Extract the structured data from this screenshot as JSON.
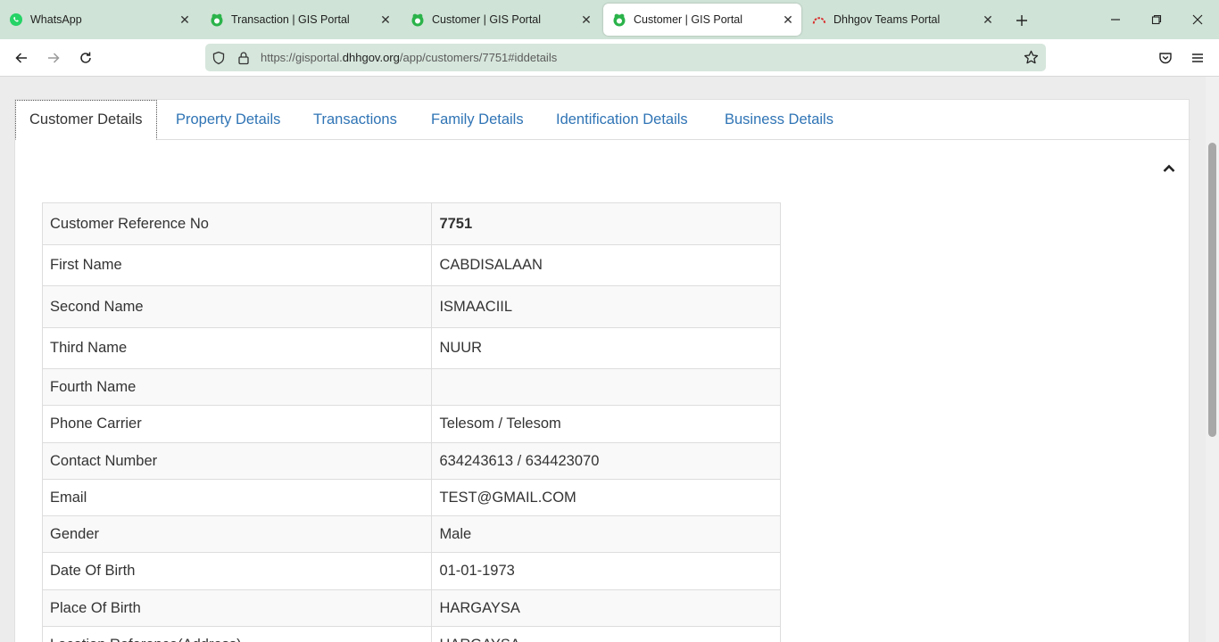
{
  "browser": {
    "tabs": [
      {
        "title": "WhatsApp",
        "icon": "whatsapp-icon",
        "active": false
      },
      {
        "title": "Transaction | GIS Portal",
        "icon": "gis-portal-icon",
        "active": false
      },
      {
        "title": "Customer | GIS Portal",
        "icon": "gis-portal-icon",
        "active": false
      },
      {
        "title": "Customer | GIS Portal",
        "icon": "gis-portal-icon",
        "active": true
      },
      {
        "title": "Dhhgov Teams Portal",
        "icon": "teams-portal-icon",
        "active": false
      }
    ],
    "url": {
      "prefix": "https://gisportal.",
      "host": "dhhgov.org",
      "path": "/app/customers/7751#iddetails"
    }
  },
  "colors": {
    "tabstrip": "#cfe3d6",
    "link": "#2f74b5",
    "whatsapp": "#25d366"
  },
  "page": {
    "tabs": [
      "Customer Details",
      "Property Details",
      "Transactions",
      "Family Details",
      "Identification Details",
      "Business Details"
    ],
    "details": [
      {
        "label": "Customer Reference No",
        "value": "7751"
      },
      {
        "label": "First Name",
        "value": "CABDISALAAN"
      },
      {
        "label": "Second Name",
        "value": "ISMAACIIL"
      },
      {
        "label": "Third Name",
        "value": "NUUR"
      },
      {
        "label": "Fourth Name",
        "value": ""
      },
      {
        "label": "Phone Carrier",
        "value": "Telesom / Telesom"
      },
      {
        "label": "Contact Number",
        "value": "634243613 / 634423070"
      },
      {
        "label": "Email",
        "value": "TEST@GMAIL.COM"
      },
      {
        "label": "Gender",
        "value": "Male"
      },
      {
        "label": "Date Of Birth",
        "value": "01-01-1973"
      },
      {
        "label": "Place Of Birth",
        "value": "HARGAYSA"
      },
      {
        "label": "Location Reference(Address)",
        "value": "HARGAYSA"
      }
    ]
  }
}
